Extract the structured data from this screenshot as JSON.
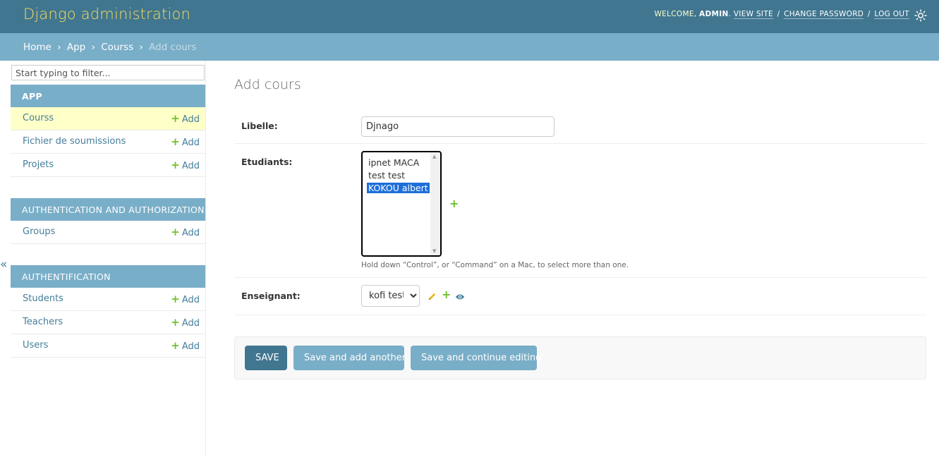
{
  "header": {
    "branding": "Django administration",
    "welcome": "WELCOME,",
    "username": "ADMIN",
    "view_site": "VIEW SITE",
    "change_password": "CHANGE PASSWORD",
    "log_out": "LOG OUT",
    "sep": "/",
    "theme_icon": "sun-icon",
    "colors": {
      "header_bg": "#417690",
      "branding": "#f5dd5d"
    }
  },
  "breadcrumbs": {
    "home": "Home",
    "app": "App",
    "model": "Courss",
    "current": "Add cours",
    "sep": "›"
  },
  "sidebar": {
    "filter_placeholder": "Start typing to filter...",
    "toggle": "«",
    "modules": [
      {
        "caption": "APP",
        "models": [
          {
            "name": "Courss",
            "add": "Add",
            "current": true
          },
          {
            "name": "Fichier de soumissions",
            "add": "Add"
          },
          {
            "name": "Projets",
            "add": "Add"
          }
        ]
      },
      {
        "caption": "AUTHENTICATION AND AUTHORIZATION",
        "models": [
          {
            "name": "Groups",
            "add": "Add"
          }
        ]
      },
      {
        "caption": "AUTHENTIFICATION",
        "models": [
          {
            "name": "Students",
            "add": "Add"
          },
          {
            "name": "Teachers",
            "add": "Add"
          },
          {
            "name": "Users",
            "add": "Add"
          }
        ]
      }
    ]
  },
  "main": {
    "title": "Add cours",
    "fields": {
      "libelle": {
        "label": "Libelle:",
        "value": "Djnago"
      },
      "etudiants": {
        "label": "Etudiants:",
        "options": [
          "ipnet MACA",
          "test test",
          "KOKOU albert"
        ],
        "selected": "KOKOU albert",
        "help": "Hold down “Control”, or “Command” on a Mac, to select more than one."
      },
      "enseignant": {
        "label": "Enseignant:",
        "value": "kofi test",
        "options": [
          "kofi test"
        ]
      }
    },
    "plus": "+",
    "buttons": {
      "save": "SAVE",
      "save_add_another": "Save and add another",
      "save_continue": "Save and continue editing"
    }
  }
}
